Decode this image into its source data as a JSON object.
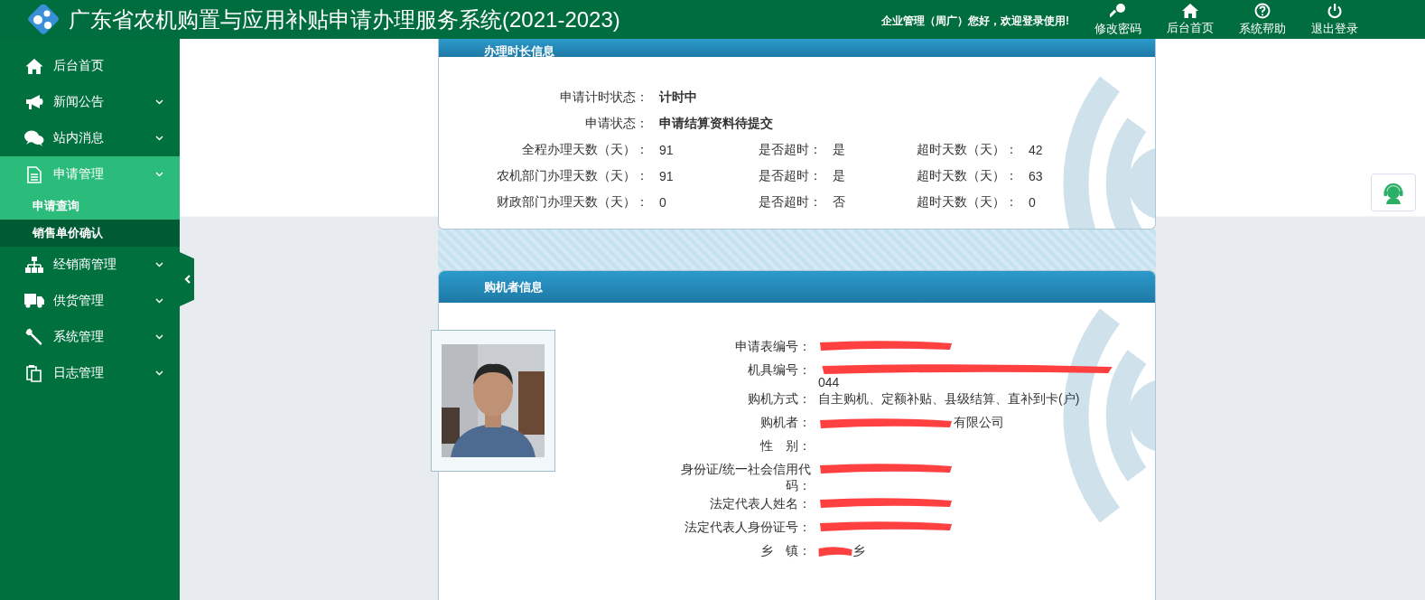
{
  "header": {
    "title": "广东省农机购置与应用补贴申请办理服务系统(2021-2023)",
    "greeting": "企业管理（周广）您好，欢迎登录使用!",
    "nav": [
      {
        "label": "修改密码",
        "kind": "key"
      },
      {
        "label": "后台首页",
        "kind": "home"
      },
      {
        "label": "系统帮助",
        "kind": "help"
      },
      {
        "label": "退出登录",
        "kind": "power"
      }
    ]
  },
  "sidebar": {
    "items": [
      {
        "label": "后台首页",
        "kind": "home",
        "expanded": false
      },
      {
        "label": "新闻公告",
        "kind": "megaphone",
        "expanded": false
      },
      {
        "label": "站内消息",
        "kind": "chat",
        "expanded": false
      },
      {
        "label": "申请管理",
        "kind": "document",
        "expanded": true,
        "children": [
          {
            "label": "申请查询",
            "selected": true
          },
          {
            "label": "销售单价确认",
            "selected": false
          }
        ]
      },
      {
        "label": "经销商管理",
        "kind": "sitemap",
        "expanded": false
      },
      {
        "label": "供货管理",
        "kind": "truck",
        "expanded": false
      },
      {
        "label": "系统管理",
        "kind": "wrench",
        "expanded": false
      },
      {
        "label": "日志管理",
        "kind": "clipboard",
        "expanded": false
      }
    ]
  },
  "timing_panel": {
    "title": "办理时长信息",
    "status_rows": [
      {
        "label": "申请计时状态：",
        "value": "计时中"
      },
      {
        "label": "申请状态：",
        "value": "申请结算资料待提交"
      }
    ],
    "day_rows": [
      {
        "days_label": "全程办理天数（天）：",
        "days": "91",
        "overdue_label": "是否超时：",
        "overdue": "是",
        "overdue_days_label": "超时天数（天）：",
        "overdue_days": "42"
      },
      {
        "days_label": "农机部门办理天数（天）：",
        "days": "91",
        "overdue_label": "是否超时：",
        "overdue": "是",
        "overdue_days_label": "超时天数（天）：",
        "overdue_days": "63"
      },
      {
        "days_label": "财政部门办理天数（天）：",
        "days": "0",
        "overdue_label": "是否超时：",
        "overdue": "否",
        "overdue_days_label": "超时天数（天）：",
        "overdue_days": "0"
      }
    ]
  },
  "buyer_panel": {
    "title": "购机者信息",
    "fields": [
      {
        "label": "申请表编号：",
        "redacted": true
      },
      {
        "label": "机具编号：",
        "redacted": true,
        "value": "044"
      },
      {
        "label": "购机方式：",
        "redacted": false,
        "value": "自主购机、定额补贴、县级结算、直补到卡(户)"
      },
      {
        "label": "购机者：",
        "redacted": true,
        "value": "有限公司"
      },
      {
        "label": "性　别：",
        "redacted": false
      },
      {
        "label": "身份证/统一社会信用代码：",
        "redacted": true
      },
      {
        "label": "法定代表人姓名：",
        "redacted": true
      },
      {
        "label": "法定代表人身份证号：",
        "redacted": true
      },
      {
        "label": "乡　镇：",
        "redacted": true,
        "value": "乡"
      }
    ]
  }
}
